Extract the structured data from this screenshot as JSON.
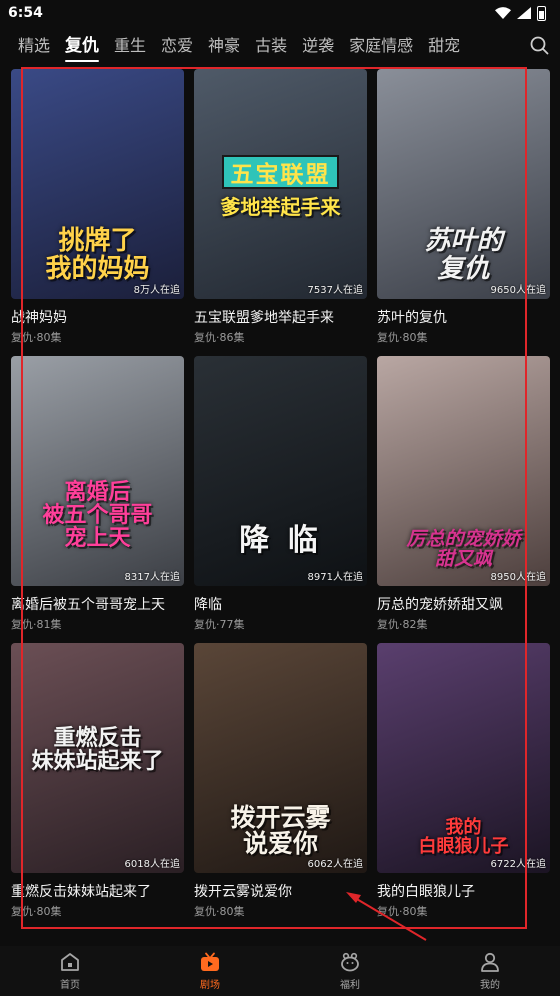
{
  "status": {
    "time": "6:54"
  },
  "tabs": [
    {
      "label": "精选",
      "active": false
    },
    {
      "label": "复仇",
      "active": true
    },
    {
      "label": "重生",
      "active": false
    },
    {
      "label": "恋爱",
      "active": false
    },
    {
      "label": "神豪",
      "active": false
    },
    {
      "label": "古装",
      "active": false
    },
    {
      "label": "逆袭",
      "active": false
    },
    {
      "label": "家庭情感",
      "active": false
    },
    {
      "label": "甜宠",
      "active": false
    }
  ],
  "dramas": [
    {
      "title": "战神妈妈",
      "meta": "复仇·80集",
      "poster_title": "挑牌了\n我的妈妈",
      "followers": "8万人在追",
      "colors": [
        "#3a4a86",
        "#1b1f3a"
      ]
    },
    {
      "title": "五宝联盟爹地举起手来",
      "meta": "复仇·86集",
      "poster_badge": "五宝联盟",
      "poster_title": "爹地举起手来",
      "followers": "7537人在追",
      "colors": [
        "#4f5a68",
        "#222831"
      ]
    },
    {
      "title": "苏叶的复仇",
      "meta": "复仇·80集",
      "poster_title": "苏叶的\n复仇",
      "followers": "9650人在追",
      "colors": [
        "#8a8f99",
        "#3b3f48"
      ]
    },
    {
      "title": "离婚后被五个哥哥宠上天",
      "meta": "复仇·81集",
      "poster_title": "离婚后\n被五个哥哥\n宠上天",
      "followers": "8317人在追",
      "colors": [
        "#9a9fa6",
        "#3c3f45"
      ]
    },
    {
      "title": "降临",
      "meta": "复仇·77集",
      "poster_title": "降 临",
      "followers": "8971人在追",
      "colors": [
        "#2a3036",
        "#0e1114"
      ]
    },
    {
      "title": "厉总的宠娇娇甜又飒",
      "meta": "复仇·82集",
      "poster_title": "厉总的宠娇娇\n甜又飒",
      "followers": "8950人在追",
      "colors": [
        "#b9a7a3",
        "#4d3f3d"
      ]
    },
    {
      "title": "重燃反击妹妹站起来了",
      "meta": "复仇·80集",
      "poster_title": "重燃反击\n妹妹站起来了",
      "followers": "6018人在追",
      "colors": [
        "#6b4f55",
        "#2a1f24"
      ]
    },
    {
      "title": "拨开云雾说爱你",
      "meta": "复仇·80集",
      "poster_title": "拨开云雾\n说爱你",
      "followers": "6062人在追",
      "colors": [
        "#5a4638",
        "#1f1814"
      ]
    },
    {
      "title": "我的白眼狼儿子",
      "meta": "复仇·80集",
      "poster_title": "我的\n白眼狼儿子",
      "followers": "6722人在追",
      "colors": [
        "#5a3f6e",
        "#1b1423"
      ]
    }
  ],
  "bottom_nav": [
    {
      "label": "首页",
      "icon": "home-icon",
      "active": false
    },
    {
      "label": "剧场",
      "icon": "tv-icon",
      "active": true
    },
    {
      "label": "福利",
      "icon": "gift-icon",
      "active": false
    },
    {
      "label": "我的",
      "icon": "user-icon",
      "active": false
    }
  ],
  "colors": {
    "accent": "#ff6a1f",
    "annotation": "#e0262a",
    "background": "#0d0d0d"
  }
}
